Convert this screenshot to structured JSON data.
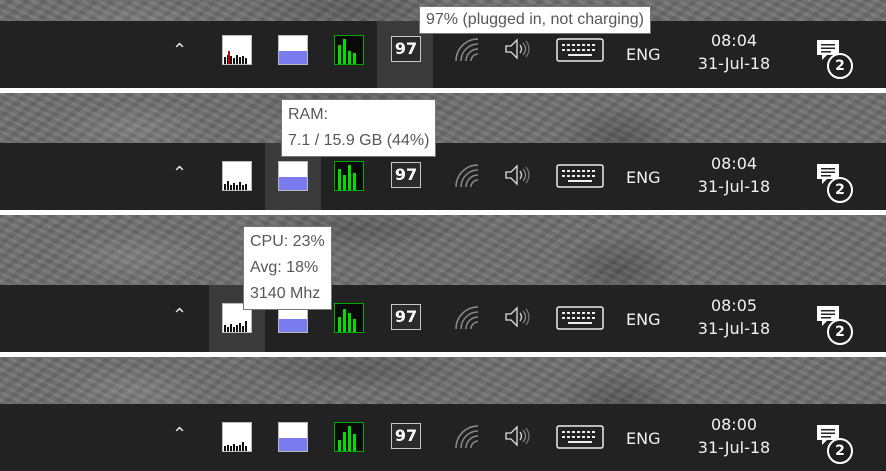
{
  "colors": {
    "taskbar": "#222222",
    "ram_fill": "#7b7bf0",
    "cpu_spike": "#cc0000",
    "net_bars": "#00cc00",
    "tooltip_text": "#575757"
  },
  "icons": {
    "chevron": "chevron-up-icon",
    "cpu": "cpu-graph-icon",
    "ram": "ram-meter-icon",
    "network": "network-graph-icon",
    "battery": "battery-icon",
    "wifi": "wifi-icon",
    "volume": "volume-icon",
    "keyboard": "touch-keyboard-icon",
    "notifications": "action-center-icon"
  },
  "rows": [
    {
      "battery": "97",
      "lang": "ENG",
      "time": "08:04",
      "date": "31-Jul-18",
      "notif_count": "2",
      "tooltip_lines": [
        "97% (plugged in, not charging)"
      ]
    },
    {
      "battery": "97",
      "lang": "ENG",
      "time": "08:04",
      "date": "31-Jul-18",
      "notif_count": "2",
      "tooltip_lines": [
        "RAM:",
        "7.1 / 15.9 GB (44%)"
      ]
    },
    {
      "battery": "97",
      "lang": "ENG",
      "time": "08:05",
      "date": "31-Jul-18",
      "notif_count": "2",
      "tooltip_lines": [
        "CPU: 23%",
        "Avg: 18%",
        "3140 Mhz"
      ]
    },
    {
      "battery": "97",
      "lang": "ENG",
      "time": "08:00",
      "date": "31-Jul-18",
      "notif_count": "2",
      "tooltip_lines": []
    }
  ]
}
